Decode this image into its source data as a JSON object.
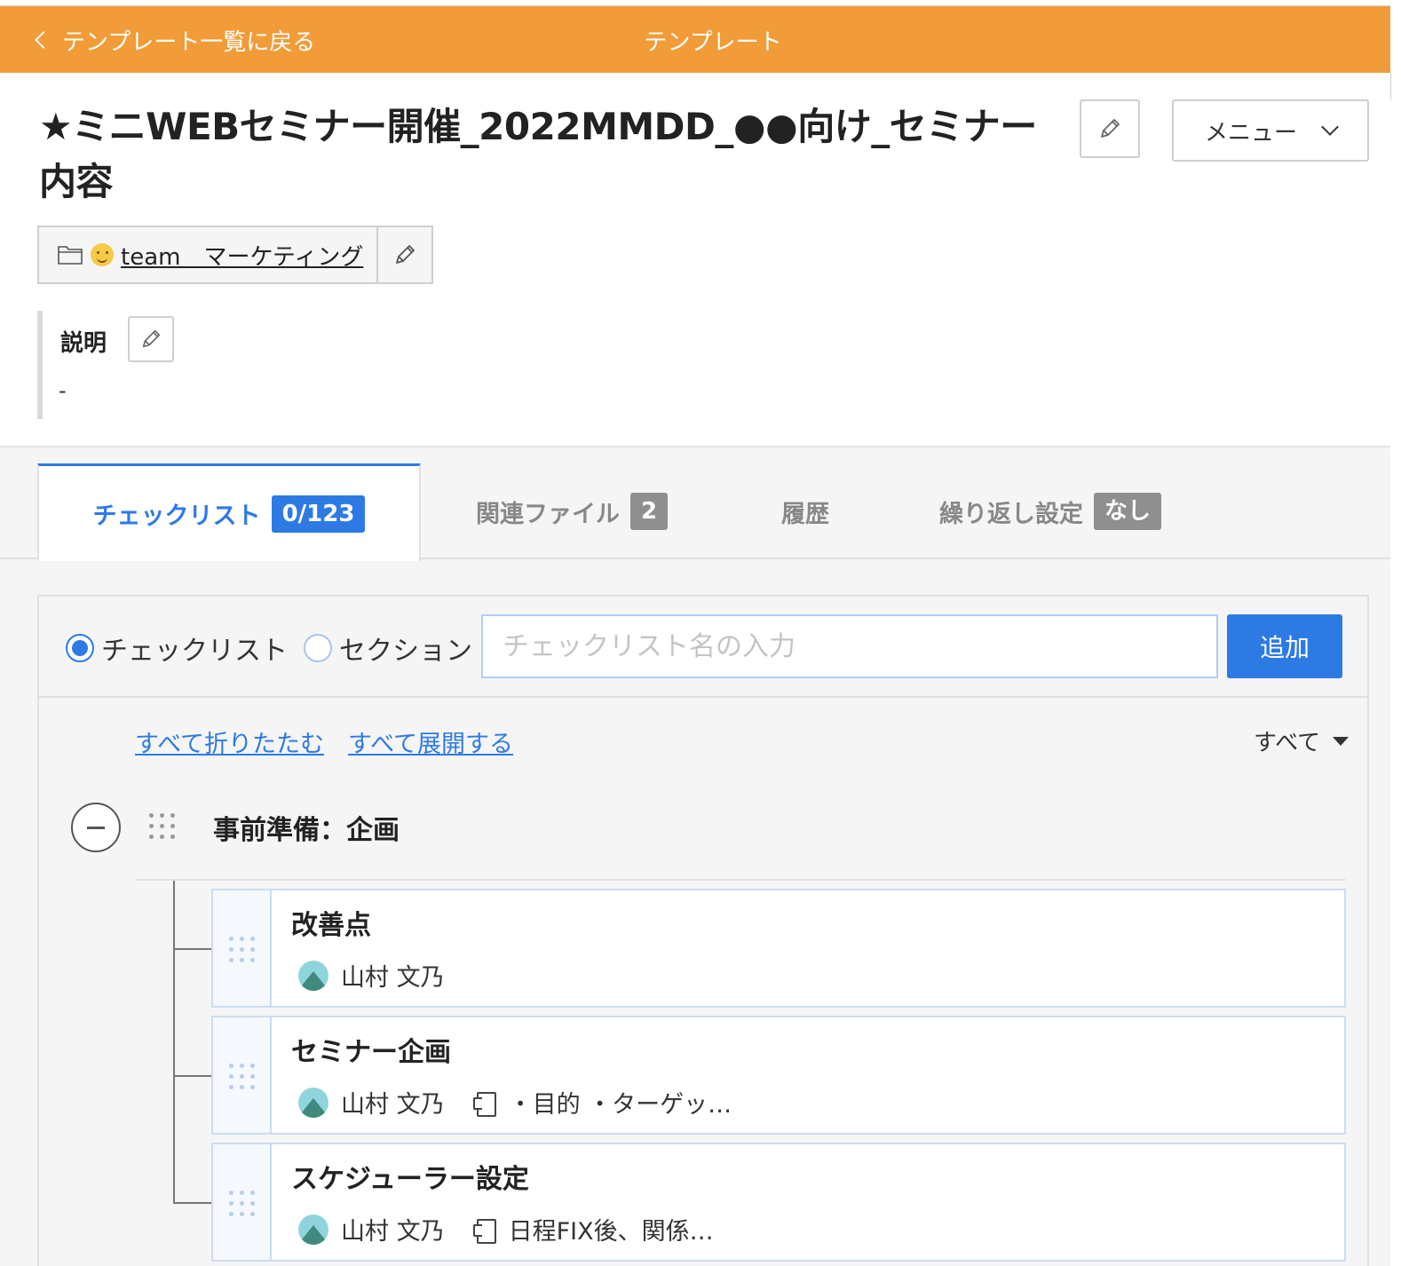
{
  "header": {
    "back_label": "テンプレート一覧に戻る",
    "title": "テンプレート",
    "bg_color": "#f19c38"
  },
  "template": {
    "title": "★ミニWEBセミナー開催_2022MMDD_●●向け_セミナー内容",
    "menu_label": "メニュー",
    "team_name": "team　マーケティング",
    "description_label": "説明",
    "description_value": "-"
  },
  "tabs": [
    {
      "label": "チェックリスト",
      "badge": "0/123",
      "active": true
    },
    {
      "label": "関連ファイル",
      "badge": "2",
      "active": false
    },
    {
      "label": "履歴",
      "badge": "",
      "active": false
    },
    {
      "label": "繰り返し設定",
      "badge": "なし",
      "active": false
    }
  ],
  "add_form": {
    "radio_checklist": "チェックリスト",
    "radio_section": "セクション",
    "selected": "チェックリスト",
    "input_placeholder": "チェックリスト名の入力",
    "input_value": "",
    "add_label": "追加"
  },
  "controls": {
    "collapse_all": "すべて折りたたむ",
    "expand_all": "すべて展開する",
    "filter": "すべて"
  },
  "section": {
    "title": "事前準備：企画",
    "items": [
      {
        "title": "改善点",
        "assignee": "山村 文乃",
        "note": ""
      },
      {
        "title": "セミナー企画",
        "assignee": "山村 文乃",
        "note": "・目的 ・ターゲッ…"
      },
      {
        "title": "スケジューラー設定",
        "assignee": "山村 文乃",
        "note": "日程FIX後、関係…"
      }
    ]
  },
  "colors": {
    "accent": "#2e7ae5",
    "header": "#f19c38"
  },
  "icons": {
    "back": "chevron-left-icon",
    "edit": "pencil-icon",
    "menu_dropdown": "chevron-down-icon",
    "team": "folder-icon",
    "team_emoji": "smiling-face-emoji",
    "drag": "drag-handle-icon",
    "collapse": "minus-circle-icon",
    "note": "memo-icon",
    "avatar": "mountain-avatar",
    "filter": "caret-down-icon"
  }
}
